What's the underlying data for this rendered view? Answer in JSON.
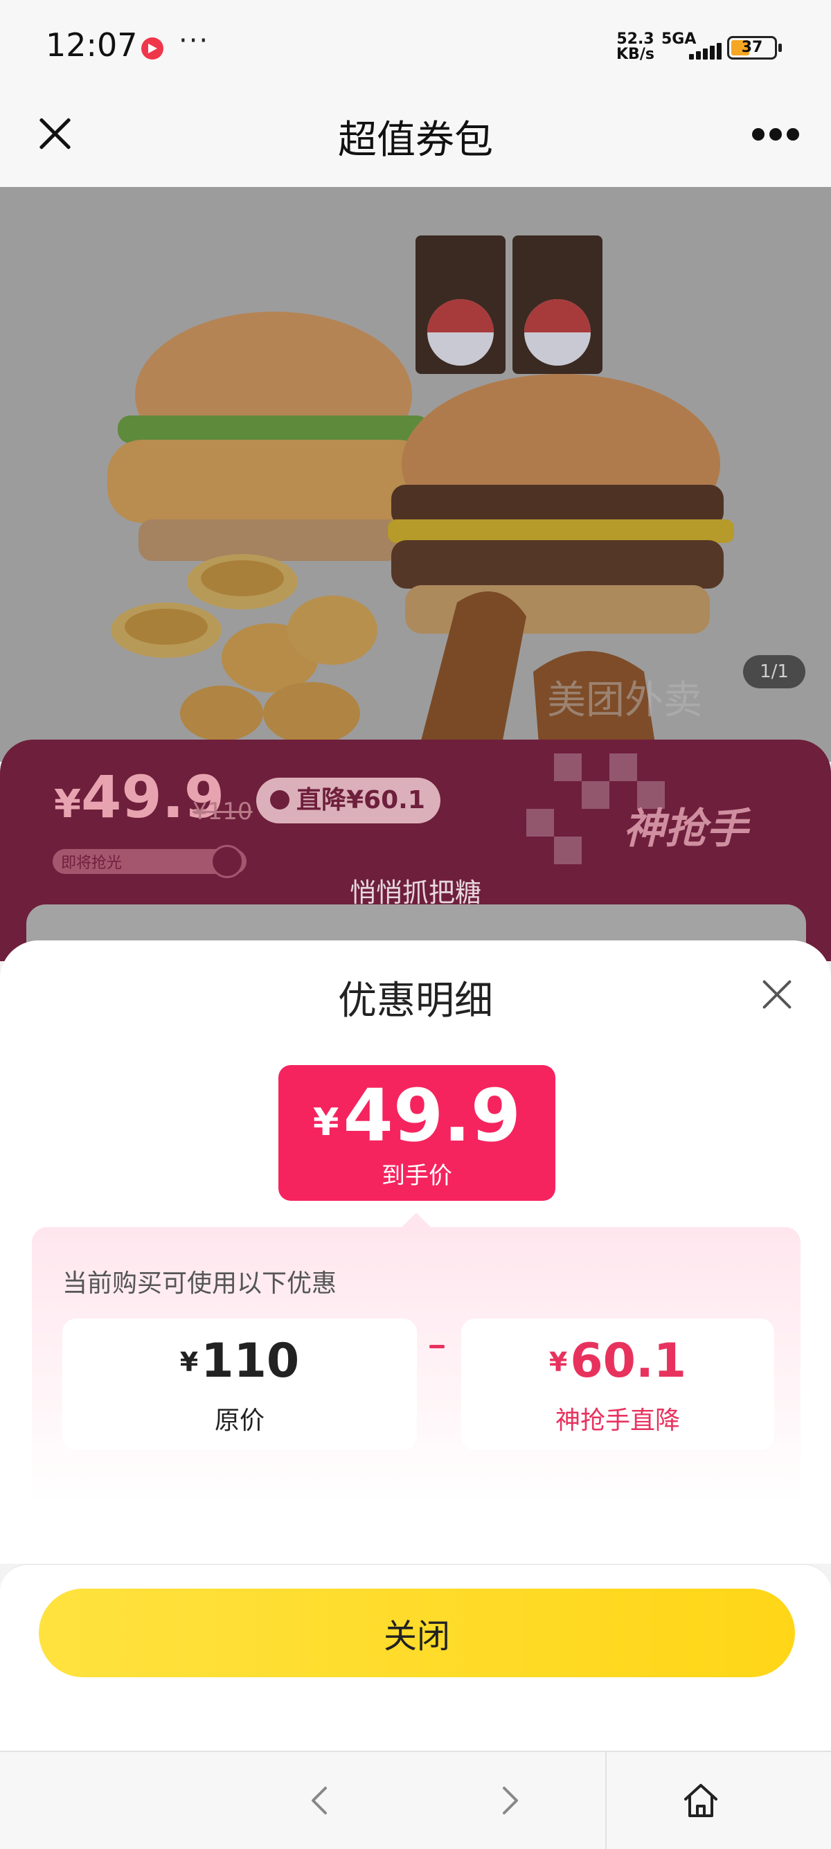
{
  "status_bar": {
    "time": "12:07",
    "dots": "···",
    "speed_top": "52.3",
    "speed_bottom": "KB/s",
    "network": "5GA",
    "battery": "37",
    "app_icon": "video-app-icon"
  },
  "title_bar": {
    "title": "超值券包",
    "close_icon": "close-icon",
    "more_icon": "more-icon"
  },
  "hero": {
    "counter": "1/1"
  },
  "deal": {
    "currency": "¥",
    "price": "49.9",
    "original_price": "¥110",
    "badge": "直降¥60.1",
    "brand": "神抢手",
    "progress_label": "即将抢光",
    "tagline": "悄悄抓把糖"
  },
  "sheet": {
    "title": "优惠明细",
    "final_currency": "¥",
    "final_price": "49.9",
    "final_label": "到手价",
    "promo_title": "当前购买可使用以下优惠",
    "original": {
      "currency": "¥",
      "amount": "110",
      "label": "原价"
    },
    "minus": "-",
    "discount": {
      "currency": "¥",
      "amount": "60.1",
      "label": "神抢手直降"
    },
    "close_button": "关闭"
  },
  "colors": {
    "accent_red": "#f5245e",
    "button_yellow": "#ffd617",
    "deal_band": "#6e1f3c"
  },
  "nav": {
    "back_icon": "chevron-left-icon",
    "forward_icon": "chevron-right-icon",
    "home_icon": "home-icon"
  }
}
